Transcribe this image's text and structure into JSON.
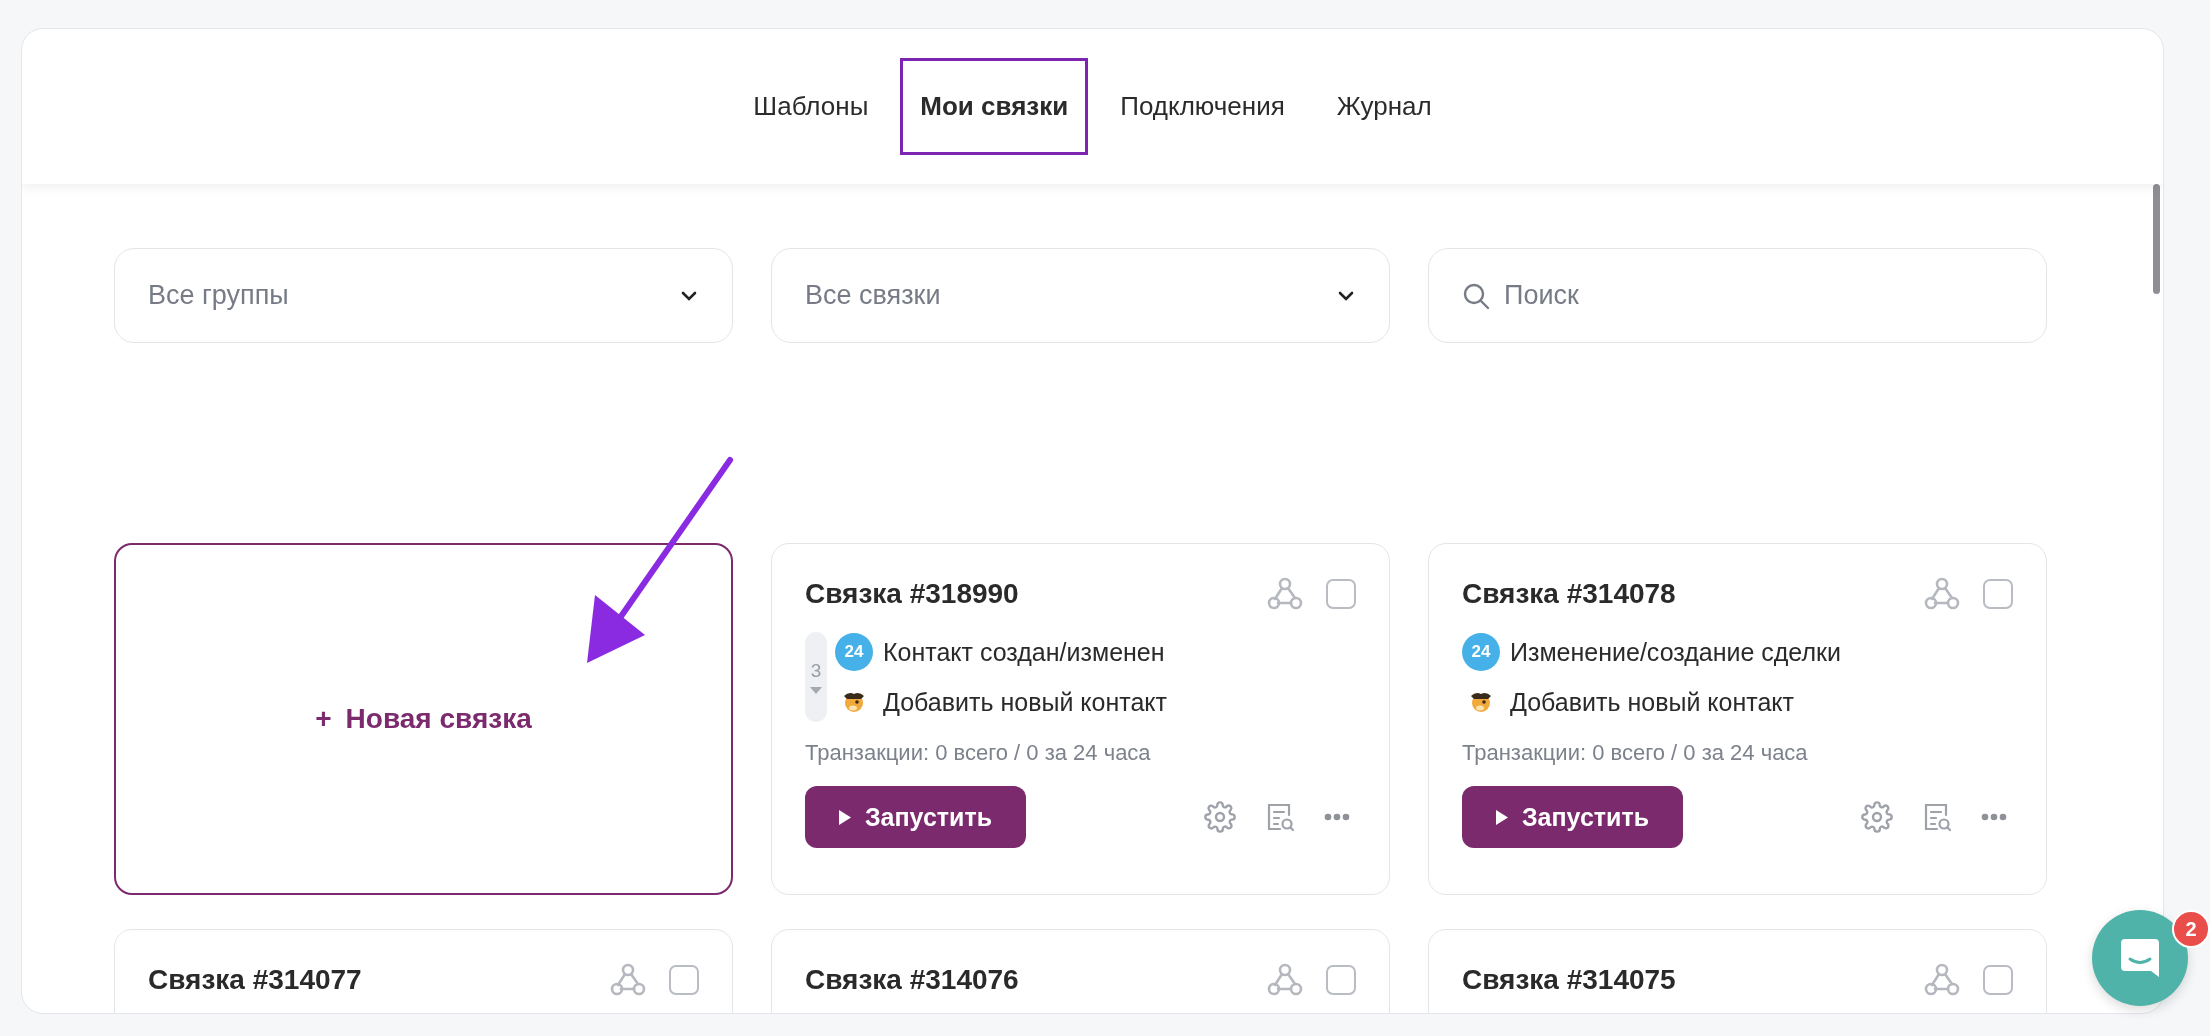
{
  "tabs": [
    {
      "label": "Шаблоны",
      "selected": false
    },
    {
      "label": "Мои связки",
      "selected": true
    },
    {
      "label": "Подключения",
      "selected": false
    },
    {
      "label": "Журнал",
      "selected": false
    }
  ],
  "filters": [
    {
      "kind": "dropdown",
      "placeholder": "Все группы"
    },
    {
      "kind": "dropdown",
      "placeholder": "Все связки"
    },
    {
      "kind": "search",
      "placeholder": "Поиск"
    }
  ],
  "new_card": {
    "label": "Новая связка",
    "icon": "+"
  },
  "cards": [
    {
      "title": "Связка #318990",
      "checked": false,
      "step_count": "3",
      "steps": [
        {
          "kind": "bitrix",
          "badge": "24",
          "text": "Контакт создан/изменен"
        },
        {
          "kind": "mascot",
          "text": "Добавить новый контакт"
        }
      ],
      "transactions": "Транзакции: 0 всего / 0 за 24 часа",
      "run_label": "Запустить"
    },
    {
      "title": "Связка #314078",
      "checked": false,
      "steps": [
        {
          "kind": "bitrix",
          "badge": "24",
          "text": "Изменение/создание сделки"
        },
        {
          "kind": "mascot",
          "text": "Добавить новый контакт"
        }
      ],
      "transactions": "Транзакции: 0 всего / 0 за 24 часа",
      "run_label": "Запустить"
    },
    {
      "title": "Связка #314077",
      "checked": false
    },
    {
      "title": "Связка #314076",
      "checked": false
    },
    {
      "title": "Связка #314075",
      "checked": false
    }
  ],
  "chat": {
    "unread": "2"
  }
}
